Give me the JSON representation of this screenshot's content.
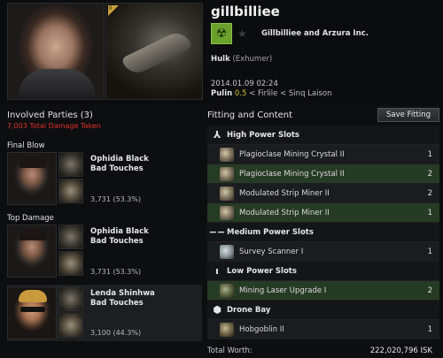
{
  "victim": {
    "name": "gillbilliee",
    "corporation": "Gillbilliee and Arzura Inc.",
    "ship": "Hulk",
    "ship_class": "(Exhumer)",
    "tech_badge": "II",
    "datetime": "2014.01.09 02:24",
    "system": "Pulin",
    "security": "0.5",
    "sep1": "<",
    "constellation": "Firlile",
    "sep2": "<",
    "region": "Sinq Laison"
  },
  "involved": {
    "title": "Involved Parties (3)",
    "damage_taken": "7,003 Total Damage Taken",
    "final_blow_label": "Final Blow",
    "top_damage_label": "Top Damage",
    "attackers": [
      {
        "name": "Ophidia Black",
        "corp": "Bad Touches",
        "damage": "3,731 (53.3%)"
      },
      {
        "name": "Ophidia Black",
        "corp": "Bad Touches",
        "damage": "3,731 (53.3%)"
      },
      {
        "name": "Lenda Shinhwa",
        "corp": "Bad Touches",
        "damage": "3,100 (44.3%)"
      }
    ]
  },
  "fitting": {
    "title": "Fitting and Content",
    "save_label": "Save Fitting",
    "high": {
      "label": "High Power Slots",
      "icon": "high-slot-icon",
      "modules": [
        {
          "name": "Plagioclase Mining Crystal II",
          "qty": "1",
          "highlight": false
        },
        {
          "name": "Plagioclase Mining Crystal II",
          "qty": "2",
          "highlight": true
        },
        {
          "name": "Modulated Strip Miner II",
          "qty": "2",
          "highlight": false
        },
        {
          "name": "Modulated Strip Miner II",
          "qty": "1",
          "highlight": true
        }
      ]
    },
    "medium": {
      "label": "Medium Power Slots",
      "icon": "medium-slot-icon",
      "modules": [
        {
          "name": "Survey Scanner I",
          "qty": "1",
          "highlight": false
        }
      ]
    },
    "low": {
      "label": "Low Power Slots",
      "icon": "low-slot-icon",
      "modules": [
        {
          "name": "Mining Laser Upgrade I",
          "qty": "2",
          "highlight": true
        }
      ]
    },
    "drone": {
      "label": "Drone Bay",
      "icon": "drone-bay-icon",
      "modules": [
        {
          "name": "Hobgoblin II",
          "qty": "1",
          "highlight": false
        }
      ]
    },
    "total_label": "Total Worth:",
    "total_value": "222,020,796 ISK"
  },
  "colors": {
    "damage_red": "#e0302a",
    "security_yellow": "#d8c232",
    "dropped_green": "#263b24",
    "corp_logo_green": "#6ca12e"
  }
}
